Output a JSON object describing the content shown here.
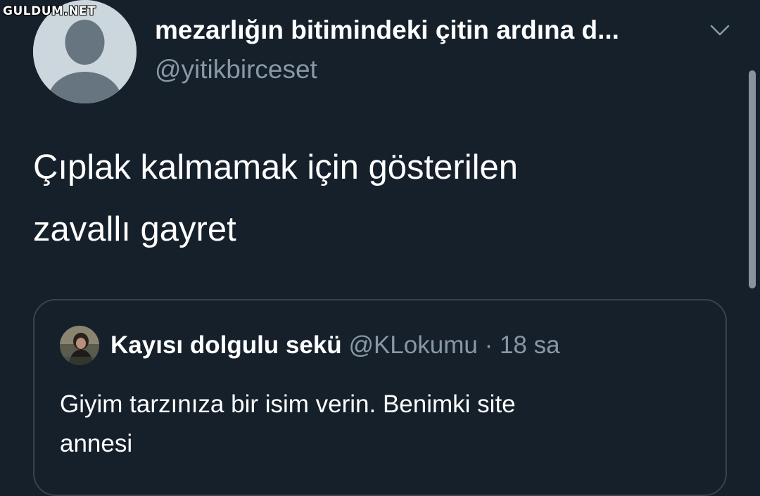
{
  "watermark": "GULDUM.NET",
  "author": {
    "display_name": "mezarlığın bitimindeki çitin ardına d...",
    "handle": "@yitikbirceset",
    "avatar_icon": "default-profile-icon"
  },
  "tweet": {
    "text_line1": "Çıplak kalmamak için gösterilen",
    "text_line2": "zavallı gayret"
  },
  "menu": {
    "icon": "chevron-down-icon"
  },
  "quoted_tweet": {
    "display_name": "Kayısı dolgulu sekü",
    "handle": "@KLokumu",
    "separator": "·",
    "time": "18 sa",
    "text_line1": "Giyim tarzınıza bir isim verin. Benimki site",
    "text_line2": "annesi",
    "avatar_icon": "user-photo-avatar"
  },
  "colors": {
    "background": "#15202b",
    "text_primary": "#ffffff",
    "text_secondary": "#8899a6",
    "border": "#38444d"
  }
}
